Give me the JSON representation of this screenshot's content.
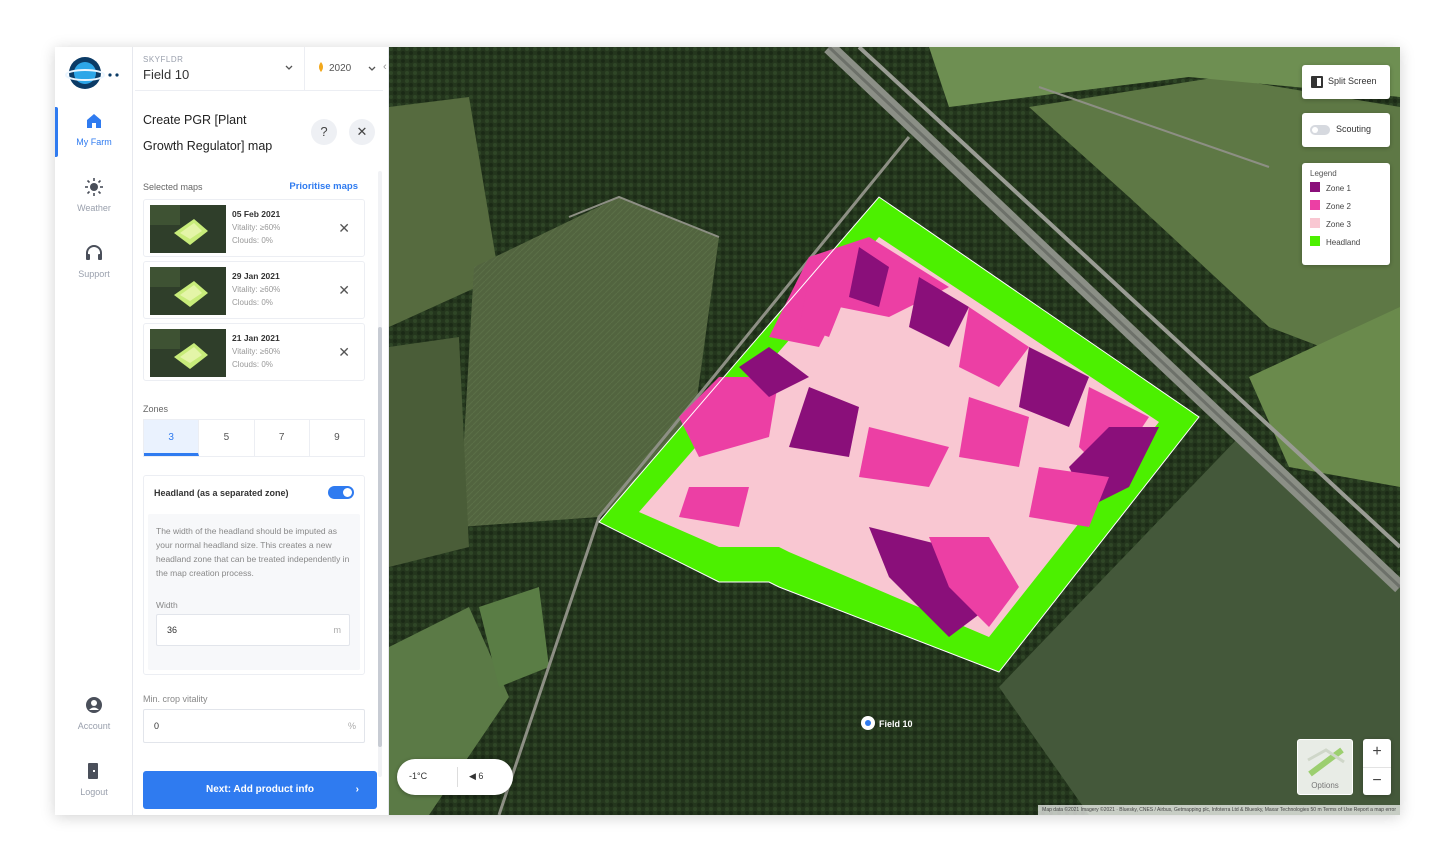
{
  "nav": {
    "items": [
      {
        "label": "My Farm",
        "icon": "home-icon"
      },
      {
        "label": "Weather",
        "icon": "sun-icon"
      },
      {
        "label": "Support",
        "icon": "headset-icon"
      },
      {
        "label": "Account",
        "icon": "user-icon"
      },
      {
        "label": "Logout",
        "icon": "logout-icon"
      }
    ]
  },
  "header": {
    "farm_caption": "SKYFLDR",
    "field_name": "Field 10",
    "season": "2020"
  },
  "panel": {
    "title_line1": "Create PGR [Plant",
    "title_line2": "Growth Regulator] map",
    "help_icon": "?",
    "close_icon": "✕",
    "selected_maps_label": "Selected maps",
    "prioritise_link": "Prioritise maps",
    "maps": [
      {
        "date": "05 Feb 2021",
        "vitality": "Vitality: ≥60%",
        "clouds": "Clouds: 0%"
      },
      {
        "date": "29 Jan 2021",
        "vitality": "Vitality: ≥60%",
        "clouds": "Clouds: 0%"
      },
      {
        "date": "21 Jan 2021",
        "vitality": "Vitality: ≥60%",
        "clouds": "Clouds: 0%"
      }
    ],
    "zones_label": "Zones",
    "zone_options": [
      "3",
      "5",
      "7",
      "9"
    ],
    "zone_selected": "3",
    "headland_title": "Headland (as a separated zone)",
    "headland_enabled": true,
    "headland_desc": "The width of the headland should be imputed as your normal headland size. This creates a new headland zone that can be treated independently in the map creation process.",
    "width_label": "Width",
    "width_value": "36",
    "width_unit": "m",
    "min_vitality_label": "Min. crop vitality",
    "min_vitality_value": "0",
    "min_vitality_unit": "%",
    "next_button": "Next: Add product info",
    "next_arrow": "›"
  },
  "map": {
    "split_screen": "Split Screen",
    "scouting": "Scouting",
    "legend_title": "Legend",
    "legend": [
      {
        "label": "Zone 1",
        "color": "#8a0f7a"
      },
      {
        "label": "Zone 2",
        "color": "#ec3fa4"
      },
      {
        "label": "Zone 3",
        "color": "#f9c7d2"
      },
      {
        "label": "Headland",
        "color": "#4cf000"
      }
    ],
    "field_label": "Field 10",
    "weather_temp": "-1°C",
    "weather_wind": "◀ 6",
    "options_label": "Options",
    "zoom_in": "+",
    "zoom_out": "−",
    "attribution": "Map data ©2021 Imagery ©2021 · Bluesky, CNES / Airbus, Getmapping plc, Infoterra Ltd & Bluesky, Maxar Technologies   50 m   Terms of Use   Report a map error"
  },
  "colors": {
    "accent": "#2f7bf0",
    "zone1": "#8a0f7a",
    "zone2": "#ec3fa4",
    "zone3": "#f9c7d2",
    "headland": "#4cf000"
  }
}
